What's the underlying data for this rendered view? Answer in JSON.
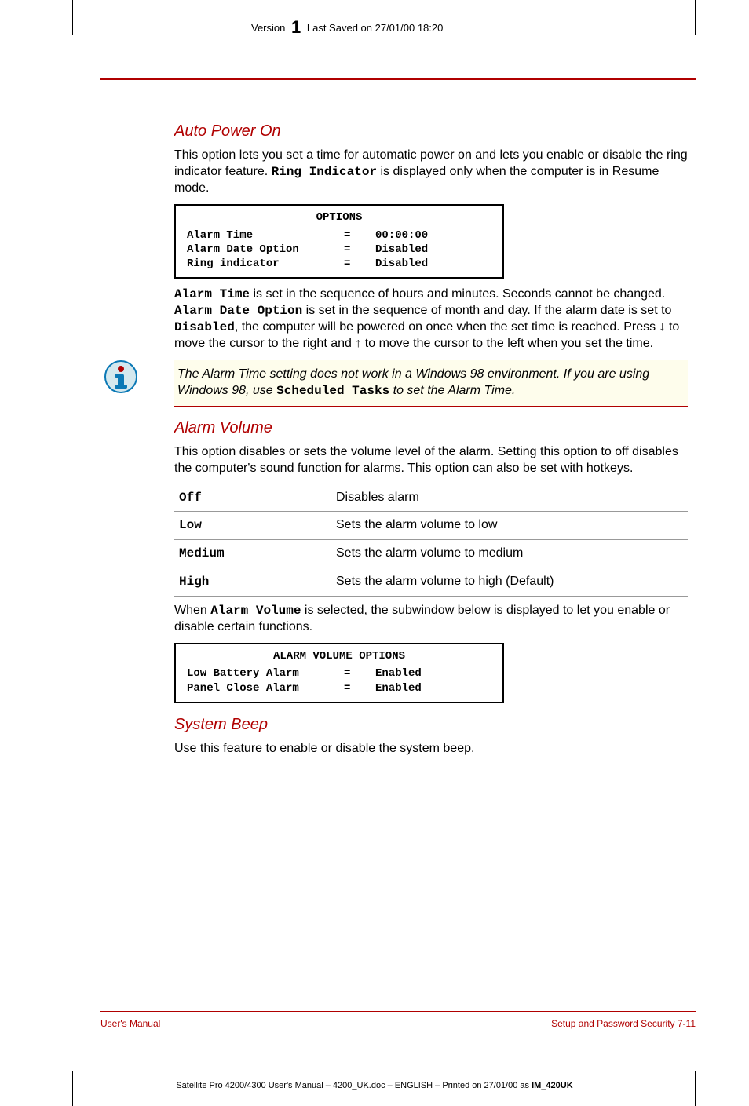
{
  "header": {
    "version_prefix": "Version",
    "version_number": "1",
    "saved_text": "Last Saved on 27/01/00 18:20"
  },
  "sections": {
    "auto_power_on": {
      "heading": "Auto Power On",
      "intro_pre": "This option lets you set a time for automatic power on and lets you enable or disable the ring indicator feature. ",
      "intro_mono": "Ring Indicator",
      "intro_post": "  is displayed only when the computer is in Resume mode.",
      "options_box": {
        "title": "OPTIONS",
        "rows": [
          {
            "label": "Alarm Time",
            "eq": "=",
            "val": "00:00:00"
          },
          {
            "label": "Alarm Date Option",
            "eq": "=",
            "val": "Disabled"
          },
          {
            "label": "Ring indicator",
            "eq": "=",
            "val": "Disabled"
          }
        ]
      },
      "p2_1_mono": "Alarm Time",
      "p2_1_post": "  is set in the sequence of hours and minutes. Seconds cannot be changed. ",
      "p2_2_mono": "Alarm Date Option",
      "p2_2_post": " is set in the sequence of month and day. If the alarm date is set to ",
      "p2_3_mono": "Disabled",
      "p2_3_post": ", the computer will be powered on once when the set time is reached. Press ↓ to move the cursor to the right and ↑ to move the cursor to the left when you set the time.",
      "note_pre": "The Alarm Time setting does not work in a Windows 98 environment. If you are using Windows 98, use ",
      "note_mono": "Scheduled Tasks",
      "note_post": " to set the Alarm Time."
    },
    "alarm_volume": {
      "heading": "Alarm Volume",
      "intro": "This option disables or sets the volume level of the alarm. Setting this option to off disables the computer's sound function for alarms. This option can also be set with hotkeys.",
      "table": [
        {
          "key": "Off",
          "desc": "Disables alarm"
        },
        {
          "key": "Low",
          "desc": "Sets the alarm volume to low"
        },
        {
          "key": "Medium",
          "desc": "Sets the alarm volume to medium"
        },
        {
          "key": "High",
          "desc": "Sets the alarm volume to high (Default)"
        }
      ],
      "p2_pre": "When ",
      "p2_mono": "Alarm Volume",
      "p2_post": " is selected, the subwindow below is displayed to let you enable or disable certain functions.",
      "options_box": {
        "title": "ALARM VOLUME OPTIONS",
        "rows": [
          {
            "label": "Low Battery Alarm",
            "eq": "=",
            "val": "Enabled"
          },
          {
            "label": "Panel Close Alarm",
            "eq": "=",
            "val": "Enabled"
          }
        ]
      }
    },
    "system_beep": {
      "heading": "System Beep",
      "intro": "Use this feature to enable or disable the system beep."
    }
  },
  "footer": {
    "left": "User's Manual",
    "right": "Setup and Password Security  7-11"
  },
  "print_footer": {
    "text": "Satellite Pro 4200/4300 User's Manual  – 4200_UK.doc – ENGLISH – Printed on 27/01/00 as ",
    "bold": "IM_420UK"
  }
}
